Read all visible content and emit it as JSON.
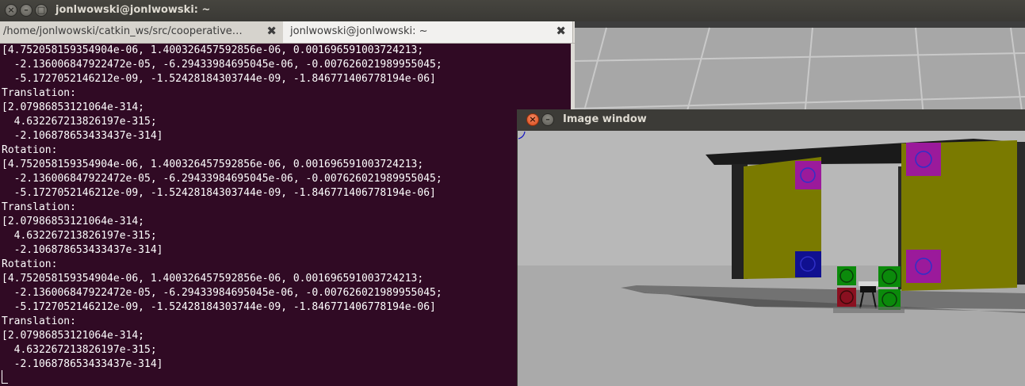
{
  "window": {
    "title": "jonlwowski@jonlwowski: ~",
    "close_symbol": "×",
    "minimize_symbol": "–"
  },
  "tabs": [
    {
      "label": "/home/jonlwowski/catkin_ws/src/cooperative…",
      "close": "✖"
    },
    {
      "label": "jonlwowski@jonlwowski: ~",
      "close": "✖"
    }
  ],
  "terminal": {
    "lines": [
      "[4.752058159354904e-06, 1.400326457592856e-06, 0.001696591003724213;",
      "  -2.136006847922472e-05, -6.29433984695045e-06, -0.007626021989955045;",
      "  -5.1727052146212e-09, -1.52428184303744e-09, -1.846771406778194e-06]",
      "Translation:",
      "[2.07986853121064e-314;",
      "  4.632267213826197e-315;",
      "  -2.106878653433437e-314]",
      "Rotation:",
      "[4.752058159354904e-06, 1.400326457592856e-06, 0.001696591003724213;",
      "  -2.136006847922472e-05, -6.29433984695045e-06, -0.007626021989955045;",
      "  -5.1727052146212e-09, -1.52428184303744e-09, -1.846771406778194e-06]",
      "Translation:",
      "[2.07986853121064e-314;",
      "  4.632267213826197e-315;",
      "  -2.106878653433437e-314]",
      "Rotation:",
      "[4.752058159354904e-06, 1.400326457592856e-06, 0.001696591003724213;",
      "  -2.136006847922472e-05, -6.29433984695045e-06, -0.007626021989955045;",
      "  -5.1727052146212e-09, -1.52428184303744e-09, -1.846771406778194e-06]",
      "Translation:",
      "[2.07986853121064e-314;",
      "  4.632267213826197e-315;",
      "  -2.106878653433437e-314]"
    ]
  },
  "image_window": {
    "title": "Image window"
  },
  "colors": {
    "terminal_bg": "#300a24",
    "panel_yellow": "#7a7a00",
    "marker_magenta": "#9b1a9b",
    "marker_blue": "#1010a0",
    "marker_green": "#0b8a0b",
    "marker_red": "#9a1020"
  }
}
